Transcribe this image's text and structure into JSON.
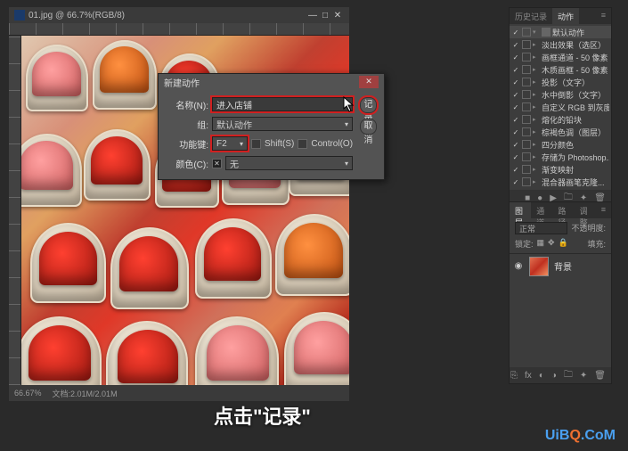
{
  "doc": {
    "title": "01.jpg @ 66.7%(RGB/8)",
    "zoom": "66.67%",
    "status": "文档:2.01M/2.01M"
  },
  "dialog": {
    "title": "新建动作",
    "name_label": "名称(N):",
    "name_value": "进入店铺",
    "set_label": "组:",
    "set_value": "默认动作",
    "fkey_label": "功能键:",
    "fkey_value": "F2",
    "shift_label": "Shift(S)",
    "ctrl_label": "Control(O)",
    "color_label": "颜色(C):",
    "color_value": "无",
    "record": "记录",
    "cancel": "取消"
  },
  "actions": {
    "tab_history": "历史记录",
    "tab_actions": "动作",
    "set_name": "默认动作",
    "items": [
      "淡出效果（选区）",
      "画框通道 - 50 像素",
      "木质画框 - 50 像素",
      "投影（文字）",
      "水中倒影（文字）",
      "自定义 RGB 到灰度",
      "熔化的铅块",
      "棕褐色调（图层）",
      "四分颜色",
      "存储为 Photoshop...",
      "渐变映射",
      "混合器画笔克隆..."
    ]
  },
  "layers": {
    "tab_layers": "图层",
    "tab_channels": "通道",
    "tab_paths": "路径",
    "tab_adjust": "调整",
    "mode": "正常",
    "opacity_label": "不透明度:",
    "lock_label": "锁定:",
    "fill_label": "填充:",
    "layer_name": "背景"
  },
  "caption": "点击\"记录\"",
  "watermark": {
    "a": "UiB",
    "b": "Q",
    "c": ".CoM"
  }
}
